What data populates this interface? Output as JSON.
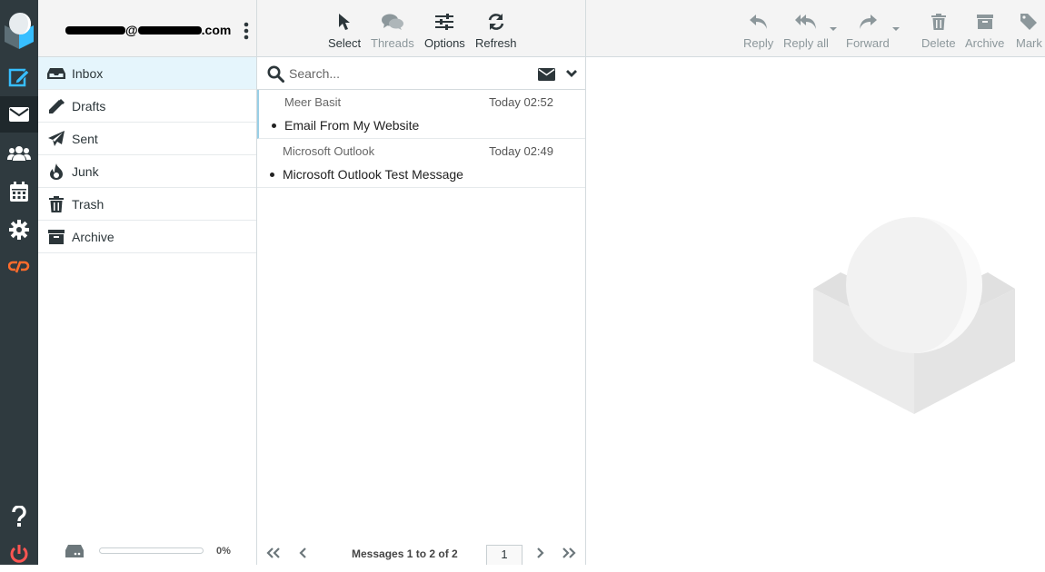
{
  "app": {
    "name": "Roundcube Webmail"
  },
  "account": {
    "email_prefix": "",
    "email_at": "@",
    "email_suffix": ".com"
  },
  "folders": [
    {
      "label": "Inbox",
      "icon": "inbox-icon",
      "selected": true
    },
    {
      "label": "Drafts",
      "icon": "pencil-icon",
      "selected": false
    },
    {
      "label": "Sent",
      "icon": "paper-plane-icon",
      "selected": false
    },
    {
      "label": "Junk",
      "icon": "fire-icon",
      "selected": false
    },
    {
      "label": "Trash",
      "icon": "trash-icon",
      "selected": false
    },
    {
      "label": "Archive",
      "icon": "archive-icon",
      "selected": false
    }
  ],
  "quota": {
    "percent_text": "0%",
    "percent": 0
  },
  "list_toolbar": {
    "select": "Select",
    "threads": "Threads",
    "options": "Options",
    "refresh": "Refresh"
  },
  "search": {
    "placeholder": "Search..."
  },
  "messages": [
    {
      "from": "Meer Basit",
      "date": "Today 02:52",
      "subject": "Email From My Website",
      "unread": true
    },
    {
      "from": "Microsoft Outlook",
      "date": "Today 02:49",
      "subject": "Microsoft Outlook Test Message",
      "unread": true
    }
  ],
  "pager": {
    "info": "Messages 1 to 2 of 2",
    "page": "1"
  },
  "preview_toolbar": {
    "reply": "Reply",
    "reply_all": "Reply all",
    "forward": "Forward",
    "delete": "Delete",
    "archive": "Archive",
    "mark": "Mark"
  },
  "colors": {
    "taskbar_bg": "#2f3a3f",
    "compose_accent": "#37beff",
    "cpanel_orange": "#ff6c2c",
    "logout_red": "#ff5552",
    "selected_folder_bg": "#e5f5fc",
    "disabled_text": "#8c979b"
  }
}
